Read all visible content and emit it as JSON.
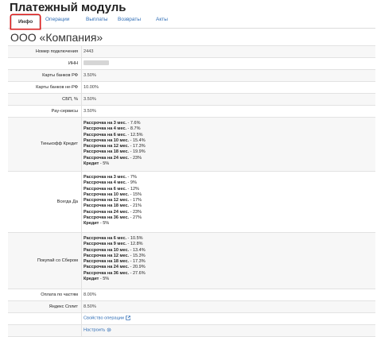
{
  "page": {
    "title": "Платежный модуль",
    "company": "ООО «Компания»"
  },
  "tabs": [
    {
      "label": "Инфо",
      "active": true
    },
    {
      "label": "Операции"
    },
    {
      "label": "Выплаты"
    },
    {
      "label": "Возвраты"
    },
    {
      "label": "Акты"
    }
  ],
  "rows": {
    "connection": {
      "label": "Номер подключения",
      "value": "2443"
    },
    "inn": {
      "label": "ИНН"
    },
    "rf_cards": {
      "label": "Карты банков РФ",
      "value": "3.50%"
    },
    "nonrf_cards": {
      "label": "Карты банков не-РФ",
      "value": "10.00%"
    },
    "sbp": {
      "label": "СБП, %",
      "value": "3.50%"
    },
    "pay": {
      "label": "Pay-сервисы",
      "value": "3.50%"
    },
    "tinkoff": {
      "label": "Тинькофф Кредит",
      "items": [
        {
          "name": "Рассрочка на 3 мес.",
          "value": "7.6%"
        },
        {
          "name": "Рассрочка на 4 мес.",
          "value": "8.7%"
        },
        {
          "name": "Рассрочка на 6 мес.",
          "value": "12.5%"
        },
        {
          "name": "Рассрочка на 10 мес.",
          "value": "15.4%"
        },
        {
          "name": "Рассрочка на 12 мес.",
          "value": "17.3%"
        },
        {
          "name": "Рассрочка на 18 мес.",
          "value": "19.9%"
        },
        {
          "name": "Рассрочка на 24 мес.",
          "value": "23%"
        },
        {
          "name": "Кредит",
          "value": "5%"
        }
      ]
    },
    "vsegda": {
      "label": "Всегда Да",
      "items": [
        {
          "name": "Рассрочка на 3 мес.",
          "value": "7%"
        },
        {
          "name": "Рассрочка на 4 мес.",
          "value": "9%"
        },
        {
          "name": "Рассрочка на 6 мес.",
          "value": "12%"
        },
        {
          "name": "Рассрочка на 10 мес.",
          "value": "15%"
        },
        {
          "name": "Рассрочка на 12 мес.",
          "value": "17%"
        },
        {
          "name": "Рассрочка на 18 мес.",
          "value": "21%"
        },
        {
          "name": "Рассрочка на 24 мес.",
          "value": "23%"
        },
        {
          "name": "Рассрочка на 36 мес.",
          "value": "27%"
        },
        {
          "name": "Кредит",
          "value": "5%"
        }
      ]
    },
    "sber": {
      "label": "Покупай со Сбером",
      "items": [
        {
          "name": "Рассрочка на 6 мес.",
          "value": "10.5%"
        },
        {
          "name": "Рассрочка на 9 мес.",
          "value": "12.8%"
        },
        {
          "name": "Рассрочка на 10 мес.",
          "value": "13.4%"
        },
        {
          "name": "Рассрочка на 12 мес.",
          "value": "15.3%"
        },
        {
          "name": "Рассрочка на 18 мес.",
          "value": "17.3%"
        },
        {
          "name": "Рассрочка на 24 мес.",
          "value": "20.9%"
        },
        {
          "name": "Рассрочка на 36 мес.",
          "value": "27.6%"
        },
        {
          "name": "Кредит",
          "value": "5%"
        }
      ]
    },
    "parts": {
      "label": "Оплата по частям",
      "value": "8.00%"
    },
    "split": {
      "label": "Яндекс Сплит",
      "value": "8.50%"
    }
  },
  "links": {
    "ops": "Свойство операции",
    "settings": "Настроить"
  },
  "colors": {
    "link": "#2f6db5",
    "highlight": "#d91a1a"
  },
  "icons": {
    "external": "external-link-icon",
    "gear": "gear-icon"
  }
}
